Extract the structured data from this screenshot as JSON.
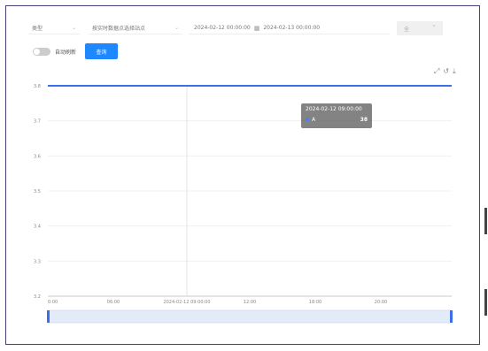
{
  "filters": {
    "type_select": "类型",
    "station_select": "按实时数据点选择站点",
    "start_time": "2024-02-12 00:00:00",
    "end_time": "2024-02-13 00:00:00",
    "extra_select": "全"
  },
  "controls": {
    "toggle_label": "自动刷新",
    "query_button": "查询"
  },
  "tooltip": {
    "time": "2024-02-12 09:00:00",
    "series": "A",
    "value": "38"
  },
  "colors": {
    "line": "#3b6ee8",
    "accent": "#1e88ff"
  },
  "icons": [
    "zoom-icon",
    "restore-icon",
    "save-icon"
  ],
  "chart_data": {
    "type": "line",
    "ylim": [
      3.2,
      3.8
    ],
    "yticks": [
      "3.8",
      "3.7",
      "3.6",
      "3.5",
      "3.4",
      "3.3",
      "3.2"
    ],
    "xticks": [
      "0:00",
      "06:00",
      "2024-02-12 09:00:00",
      "12:00",
      "18:00",
      "20:00"
    ],
    "series": [
      {
        "name": "A",
        "x": [
          "00:00",
          "23:00"
        ],
        "values": [
          3.8,
          3.8
        ]
      }
    ],
    "grid": true,
    "dataZoom": true
  }
}
